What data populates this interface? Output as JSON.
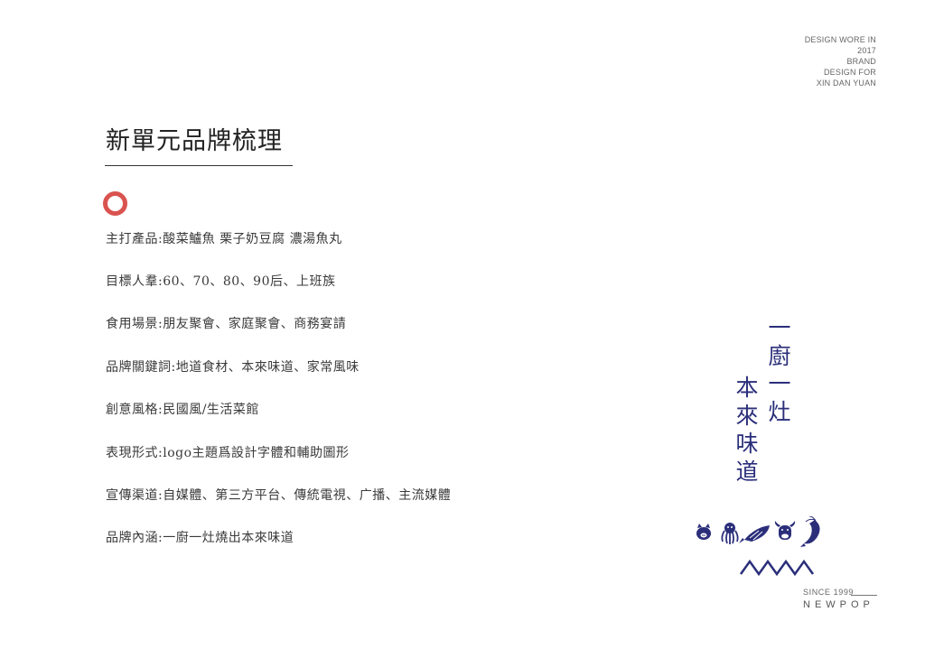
{
  "corner_text": [
    "DESIGN WORE IN",
    "2017",
    "BRAND",
    "DESIGN FOR",
    "XIN DAN YUAN"
  ],
  "title": "新單元品牌梳理",
  "accent_color": "#d9534f",
  "brand_color": "#2b2f7a",
  "items": [
    "主打產品:酸菜鱸魚 栗子奶豆腐 濃湯魚丸",
    "目標人羣:60、70、80、90后、上班族",
    "食用場景:朋友聚會、家庭聚會、商務宴請",
    "品牌關鍵詞:地道食材、本來味道、家常風味",
    "創意風格:民國風/生活菜館",
    "表現形式:logo主題爲設計字體和輔助圖形",
    "宣傳渠道:自媒體、第三方平台、傳統電視、广播、主流媒體",
    "品牌內涵:一廚一灶燒出本來味道"
  ],
  "slogan": {
    "line1": [
      "一",
      "廚",
      "一",
      "灶"
    ],
    "line2": [
      "本",
      "來",
      "味",
      "道"
    ]
  },
  "animal_icons": [
    "pig-icon",
    "octopus-icon",
    "fish-icon",
    "cow-icon",
    "shrimp-icon"
  ],
  "footer": {
    "since": "SINCE  1999",
    "brand": "NEWPOP"
  }
}
